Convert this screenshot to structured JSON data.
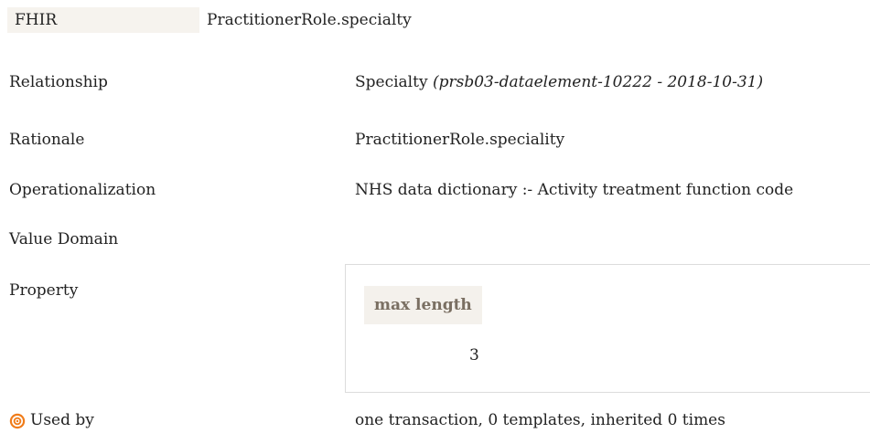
{
  "fhir": {
    "tag": "FHIR",
    "path": "PractitionerRole.specialty"
  },
  "rows": {
    "relationship": {
      "label": "Relationship",
      "value": "Specialty",
      "ref": "(prsb03-dataelement-10222 - 2018-10-31)"
    },
    "rationale": {
      "label": "Rationale",
      "value": "PractitionerRole.speciality"
    },
    "operationalization": {
      "label": "Operationalization",
      "value": "NHS data dictionary :- Activity treatment function code"
    },
    "value_domain": {
      "label": "Value Domain"
    },
    "property": {
      "label": "Property",
      "header": "max length",
      "value": "3"
    },
    "used_by": {
      "label": "Used by",
      "icon": "target-icon",
      "value": "one transaction, 0 templates, inherited 0 times"
    }
  },
  "colors": {
    "header_bg": "#f4f1ec",
    "header_text": "#7a6f62",
    "icon_orange": "#f07c1a"
  }
}
